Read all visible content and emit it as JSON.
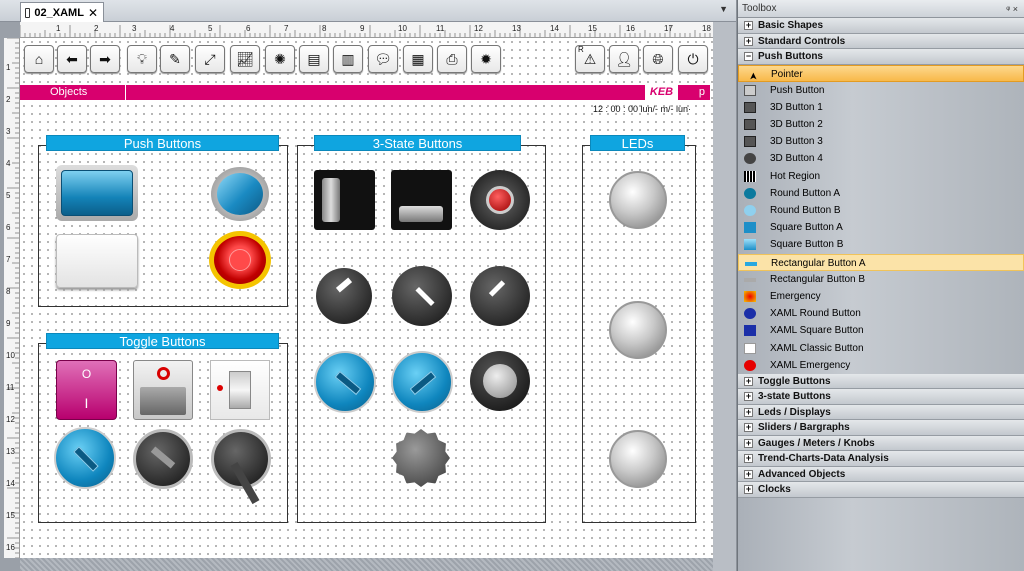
{
  "window": {
    "tab_title": "02_XAML",
    "tab_close": "✕",
    "dropdown": "▼"
  },
  "ruler": {
    "h_labels": [
      "1",
      "2",
      "3",
      "4",
      "5",
      "6",
      "7",
      "8",
      "9",
      "10",
      "11",
      "12",
      "13",
      "14",
      "15",
      "16",
      "17",
      "18"
    ],
    "v_labels": [
      "1",
      "2",
      "3",
      "4",
      "5",
      "6",
      "7",
      "8",
      "9",
      "10",
      "11",
      "12",
      "13",
      "14",
      "15",
      "16"
    ]
  },
  "toolbar": {
    "left_icons": [
      "home-icon",
      "back-icon",
      "forward-icon",
      "lightbulb-icon",
      "tool-icon",
      "resize-icon",
      "chart-icon",
      "alarm-icon",
      "document-icon",
      "book-icon",
      "chat-icon",
      "clapper-icon",
      "printer-icon",
      "settings-icon"
    ],
    "right_icons": [
      "warning-icon",
      "user-icon",
      "globe-icon",
      "power-icon"
    ],
    "warning_superscript": "R"
  },
  "header_bar": {
    "label": "Objects",
    "logo": "KEB",
    "right_label": "p",
    "color": "#d8006e"
  },
  "status_clock": "12 : 00 : 00  lun/- m/-    lun·",
  "panels": {
    "push_buttons": "Push Buttons",
    "three_state": "3-State Buttons",
    "leds": "LEDs",
    "toggle_buttons": "Toggle Buttons"
  },
  "toggle_labels": {
    "zero": "O",
    "one": "I"
  },
  "accent": "#0fa5e0",
  "toolbox": {
    "title": "Toolbox",
    "pin": "ᵠ ×",
    "groups_top": [
      "Basic Shapes",
      "Standard Controls",
      "Push Buttons"
    ],
    "items": [
      {
        "label": "Pointer",
        "icon": "pointer-icon",
        "state": "selected"
      },
      {
        "label": "Push Button",
        "icon": "push-button-icon"
      },
      {
        "label": "3D Button 1",
        "icon": "3d-button-1-icon"
      },
      {
        "label": "3D Button 2",
        "icon": "3d-button-2-icon"
      },
      {
        "label": "3D Button 3",
        "icon": "3d-button-3-icon"
      },
      {
        "label": "3D Button 4",
        "icon": "3d-button-4-icon"
      },
      {
        "label": "Hot Region",
        "icon": "hot-region-icon"
      },
      {
        "label": "Round Button A",
        "icon": "round-button-a-icon"
      },
      {
        "label": "Round Button B",
        "icon": "round-button-b-icon"
      },
      {
        "label": "Square Button A",
        "icon": "square-button-a-icon"
      },
      {
        "label": "Square Button B",
        "icon": "square-button-b-icon"
      },
      {
        "label": "Rectangular Button A",
        "icon": "rect-button-a-icon",
        "state": "highlight"
      },
      {
        "label": "Rectangular Button B",
        "icon": "rect-button-b-icon"
      },
      {
        "label": "Emergency",
        "icon": "emergency-icon"
      },
      {
        "label": "XAML Round Button",
        "icon": "xaml-round-icon"
      },
      {
        "label": "XAML Square Button",
        "icon": "xaml-square-icon"
      },
      {
        "label": "XAML Classic Button",
        "icon": "xaml-classic-icon"
      },
      {
        "label": "XAML Emergency",
        "icon": "xaml-emergency-icon"
      }
    ],
    "groups_bottom": [
      "Toggle Buttons",
      "3-state Buttons",
      "Leds / Displays",
      "Sliders / Bargraphs",
      "Gauges / Meters / Knobs",
      "Trend-Charts-Data Analysis",
      "Advanced Objects",
      "Clocks"
    ]
  }
}
